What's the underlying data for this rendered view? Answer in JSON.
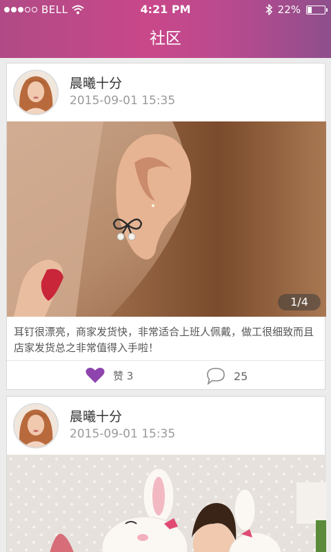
{
  "status_bar": {
    "carrier": "BELL",
    "time": "4:21 PM",
    "battery_percent": "22%",
    "battery_level": 0.22
  },
  "header": {
    "title": "社区"
  },
  "posts": [
    {
      "username": "晨曦十分",
      "datetime": "2015-09-01 15:35",
      "photo_counter": "1/4",
      "caption": "耳钉很漂亮，商家发货快，非常适合上班人佩戴，做工很细致而且店家发货总之非常值得入手啦！",
      "like_label": "赞 3",
      "comment_count": "25"
    },
    {
      "username": "晨曦十分",
      "datetime": "2015-09-01 15:35"
    }
  ],
  "colors": {
    "header_start": "#b04a86",
    "header_end": "#8e4f8c",
    "like_heart": "#8e44ad"
  }
}
